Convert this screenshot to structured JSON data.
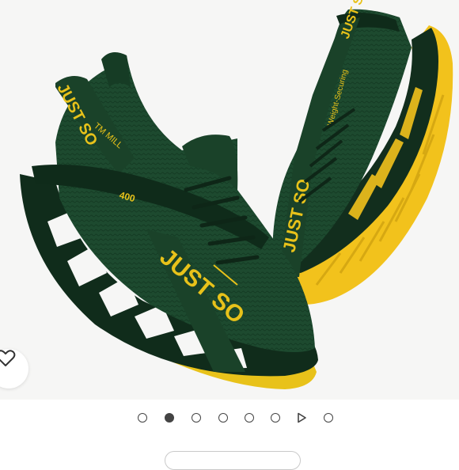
{
  "product": {
    "image_alt": "Green and yellow JUST SO running sneakers",
    "shoe_text": {
      "brand_main": "JUST SO",
      "brand_top": "JUST SO",
      "tag_left": "TM MILL",
      "tag_small": "Weight-Securing",
      "series": "400"
    },
    "colors": {
      "upper": "#1c4a2e",
      "upper_dark": "#0f2b1a",
      "accent": "#e8c21a",
      "sole": "#f2c21c"
    }
  },
  "favorite": {
    "icon": "heart-outline-icon"
  },
  "carousel": {
    "total": 8,
    "active_index": 1,
    "video_index": 6
  }
}
